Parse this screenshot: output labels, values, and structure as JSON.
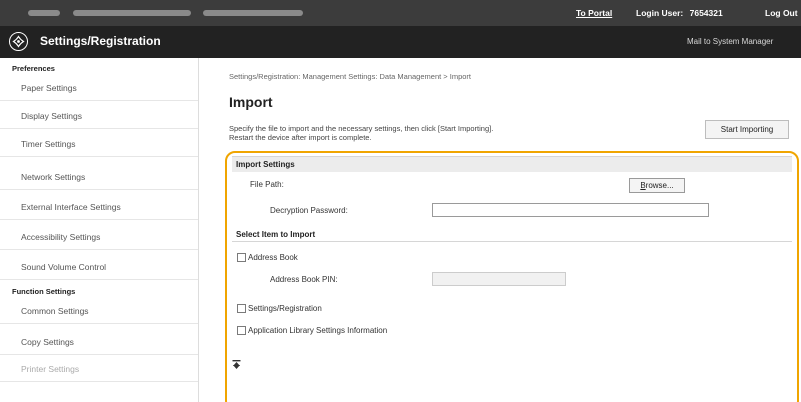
{
  "topbar": {
    "to_portal": "To Portal",
    "login_user_label": "Login User:",
    "login_user_id": "7654321",
    "logout": "Log Out"
  },
  "titlebar": {
    "title": "Settings/Registration",
    "mail_link": "Mail to System Manager"
  },
  "sidebar": {
    "preferences_heading": "Preferences",
    "preferences_items": [
      "Paper Settings",
      "Display Settings",
      "Timer Settings",
      "Network Settings",
      "External Interface Settings",
      "Accessibility Settings",
      "Sound Volume Control"
    ],
    "function_heading": "Function Settings",
    "function_items": [
      "Common Settings",
      "Copy Settings",
      "Printer Settings"
    ]
  },
  "main": {
    "breadcrumb": "Settings/Registration: Management Settings: Data Management > Import",
    "title": "Import",
    "desc_line1": "Specify the file to import and the necessary settings, then click [Start Importing].",
    "desc_line2": "Restart the device after import is complete.",
    "start_button": "Start Importing",
    "import_settings": {
      "heading": "Import Settings",
      "file_path_label": "File Path:",
      "browse_button_underlined": "B",
      "browse_button_rest": "rowse...",
      "decryption_label": "Decryption Password:",
      "select_heading": "Select Item to Import",
      "address_book_label": "Address Book",
      "address_book_pin_label": "Address Book PIN:",
      "settings_label": "Settings/Registration",
      "app_library_label": "Application Library Settings Information"
    }
  }
}
